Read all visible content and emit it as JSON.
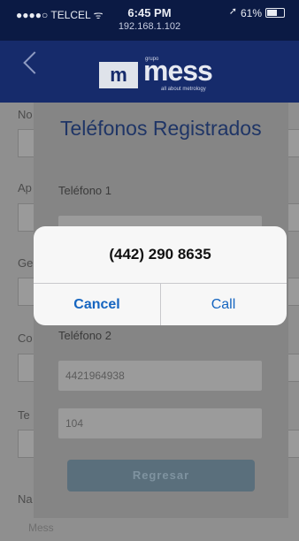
{
  "status_bar": {
    "carrier": "●●●●○ TELCEL ᯤ",
    "time": "6:45 PM",
    "url": "192.168.1.102",
    "battery": "61%"
  },
  "header": {
    "logo_letter": "m",
    "logo_word": "mess",
    "logo_grupo": "grupo",
    "logo_tagline": "all about metrology"
  },
  "background_form": {
    "labels": [
      "No",
      "Ap",
      "Ge",
      "Co",
      "Te",
      "Na"
    ],
    "value_bottom": "Mess"
  },
  "card": {
    "title": "Teléfonos Registrados",
    "label_phone1": "Teléfono 1",
    "label_phone2": "Teléfono 2",
    "phone2_value": "4421964938",
    "extension_value": "104",
    "back_button": "Regresar"
  },
  "alert": {
    "title": "(442) 290 8635",
    "cancel_label": "Cancel",
    "call_label": "Call"
  }
}
